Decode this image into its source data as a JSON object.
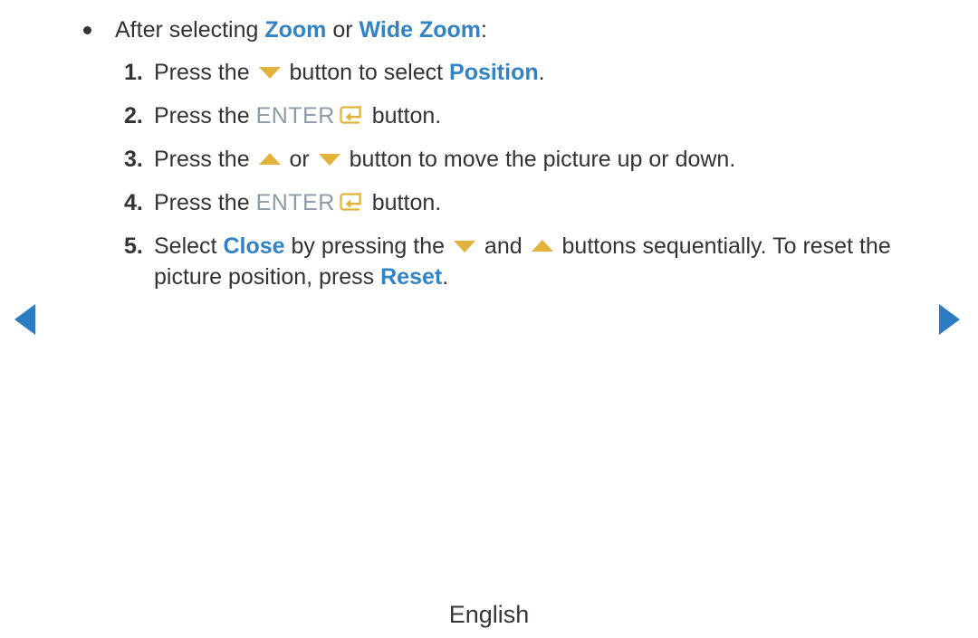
{
  "page": {
    "background_color": "#ffffff",
    "text_color": "#333333",
    "accent_blue": "#3383c4",
    "accent_gold": "#e2b33c",
    "enter_gray": "#8c9ba5",
    "nav_blue": "#2b7cc0"
  },
  "bullet": {
    "lead_text": "After selecting ",
    "term_1": "Zoom",
    "conjunction": " or ",
    "term_2": "Wide Zoom",
    "trailing": ":"
  },
  "steps": [
    {
      "number": "1.",
      "segments": {
        "a": "Press the ",
        "icon": "arrow-down-icon",
        "b": " button to select ",
        "highlight": "Position",
        "c": "."
      }
    },
    {
      "number": "2.",
      "segments": {
        "a": "Press the ",
        "key_label": "ENTER",
        "icon": "enter-key-icon",
        "b": " button."
      }
    },
    {
      "number": "3.",
      "segments": {
        "a": "Press the ",
        "icon_1": "arrow-up-icon",
        "b": " or ",
        "icon_2": "arrow-down-icon",
        "c": " button to move the picture up or down."
      }
    },
    {
      "number": "4.",
      "segments": {
        "a": "Press the ",
        "key_label": "ENTER",
        "icon": "enter-key-icon",
        "b": " button."
      }
    },
    {
      "number": "5.",
      "segments": {
        "a": "Select ",
        "highlight_1": "Close",
        "b": " by pressing the ",
        "icon_1": "arrow-down-icon",
        "c": " and ",
        "icon_2": "arrow-up-icon",
        "d": " buttons sequentially. To reset the",
        "line2_a": "picture position, press ",
        "highlight_2": "Reset",
        "line2_b": "."
      }
    }
  ],
  "navigation": {
    "prev_icon": "triangle-left-icon",
    "next_icon": "triangle-right-icon"
  },
  "footer": {
    "language": "English"
  }
}
